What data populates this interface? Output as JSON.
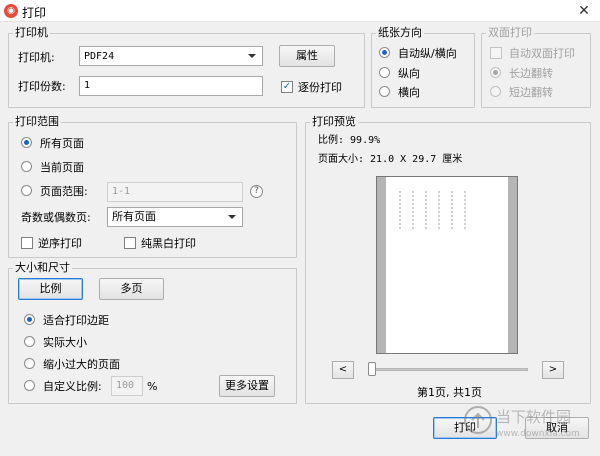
{
  "window": {
    "title": "打印",
    "app_icon_glyph": "◉"
  },
  "printer": {
    "legend": "打印机",
    "printer_label": "打印机:",
    "printer_value": "PDF24",
    "properties_button": "属性",
    "copies_label": "打印份数:",
    "copies_value": "1",
    "collate_label": "逐份打印",
    "collate_checked": true
  },
  "orientation": {
    "legend": "纸张方向",
    "options": [
      "自动纵/横向",
      "纵向",
      "横向"
    ],
    "selected": 0
  },
  "duplex": {
    "legend": "双面打印",
    "auto_label": "自动双面打印",
    "long_edge": "长边翻转",
    "short_edge": "短边翻转",
    "selected": 0
  },
  "range": {
    "legend": "打印范围",
    "all_pages": "所有页面",
    "current_page": "当前页面",
    "page_range": "页面范围:",
    "page_range_placeholder": "1-1",
    "odd_even_label": "奇数或偶数页:",
    "odd_even_value": "所有页面",
    "reverse_label": "逆序打印",
    "grayscale_label": "纯黑白打印",
    "selected": 0
  },
  "size": {
    "legend": "大小和尺寸",
    "scale_tab": "比例",
    "multipage_tab": "多页",
    "fit_margins": "适合打印边距",
    "actual_size": "实际大小",
    "shrink_large": "缩小过大的页面",
    "custom_scale": "自定义比例:",
    "custom_value": "100",
    "percent": "%",
    "more_settings": "更多设置",
    "selected": 0
  },
  "preview": {
    "legend": "打印预览",
    "scale_text": "比例: 99.9%",
    "page_size_text": "页面大小: 21.0 X 29.7 厘米",
    "prev_glyph": "<",
    "next_glyph": ">",
    "page_indicator": "第1页, 共1页"
  },
  "footer": {
    "print_button": "打印",
    "cancel_button": "取消"
  },
  "watermark": {
    "text_cn": "当下软件园",
    "text_url": "www.downxia.com"
  },
  "colors": {
    "accent": "#1a64c8",
    "app_icon": "#e74b3c",
    "background": "#f0f0f0"
  }
}
